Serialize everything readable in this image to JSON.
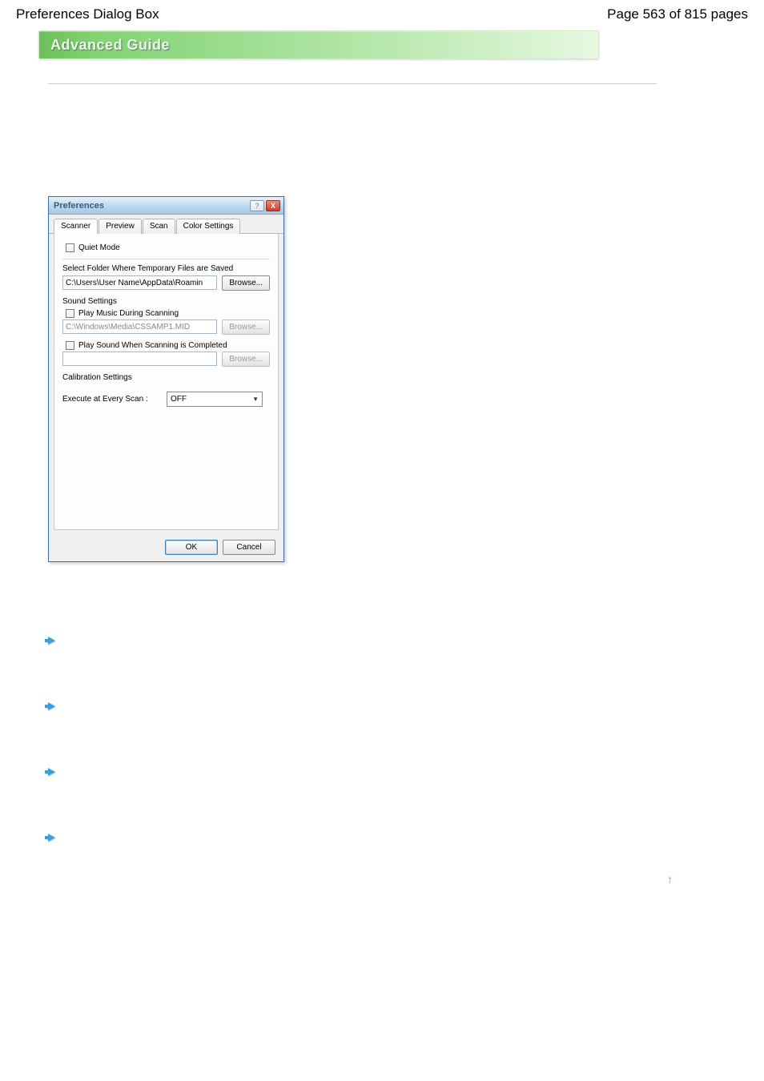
{
  "header": {
    "title": "Preferences Dialog Box",
    "page_info": "Page 563 of 815 pages"
  },
  "banner": {
    "text": "Advanced Guide"
  },
  "dialog": {
    "title": "Preferences",
    "window_buttons": {
      "help": "?",
      "close": "X"
    },
    "tabs": {
      "scanner": "Scanner",
      "preview": "Preview",
      "scan": "Scan",
      "color_settings": "Color Settings"
    },
    "scanner_tab": {
      "quiet_mode": "Quiet Mode",
      "temp_folder_label": "Select Folder Where Temporary Files are Saved",
      "temp_folder_path": "C:\\Users\\User Name\\AppData\\Roamin",
      "browse1": "Browse...",
      "sound_settings": "Sound Settings",
      "play_during": "Play Music During Scanning",
      "play_during_path": "C:\\Windows\\Media\\CSSAMP1.MID",
      "browse2": "Browse...",
      "play_complete": "Play Sound When Scanning is Completed",
      "play_complete_path": "",
      "browse3": "Browse...",
      "calibration_settings": "Calibration Settings",
      "execute_label": "Execute at Every Scan :",
      "execute_value": "OFF"
    },
    "footer": {
      "ok": "OK",
      "cancel": "Cancel"
    }
  },
  "pagetop": {
    "glyph": "↑"
  }
}
